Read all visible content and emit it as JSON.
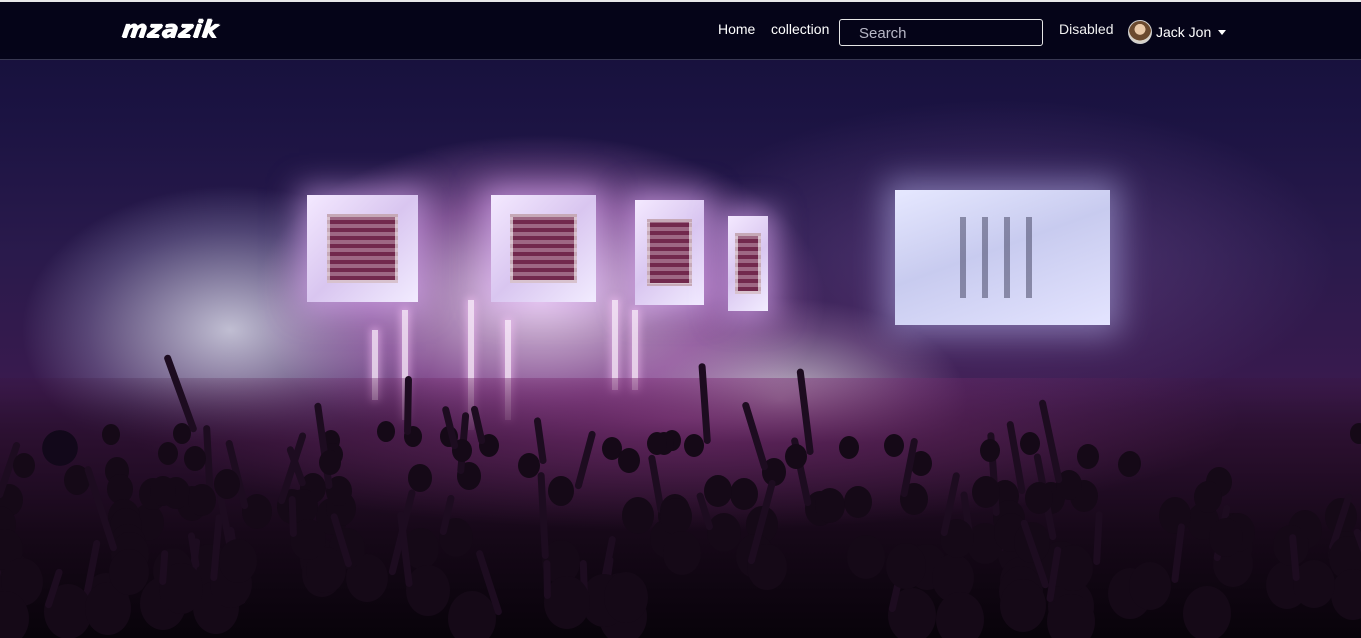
{
  "brand": {
    "name": "mzazik"
  },
  "nav": {
    "home_label": "Home",
    "collection_label": "collection",
    "disabled_label": "Disabled"
  },
  "search": {
    "placeholder": "Search",
    "value": ""
  },
  "user": {
    "name": "Jack Jon",
    "avatar_icon": "user-avatar",
    "menu_icon": "caret-down-icon"
  },
  "hero": {
    "scene": "concert-crowd-image",
    "accent": "#d7a3e6"
  },
  "colors": {
    "navbar_bg": "#040316",
    "text": "#ffffff",
    "search_border": "#e6e6e6"
  }
}
